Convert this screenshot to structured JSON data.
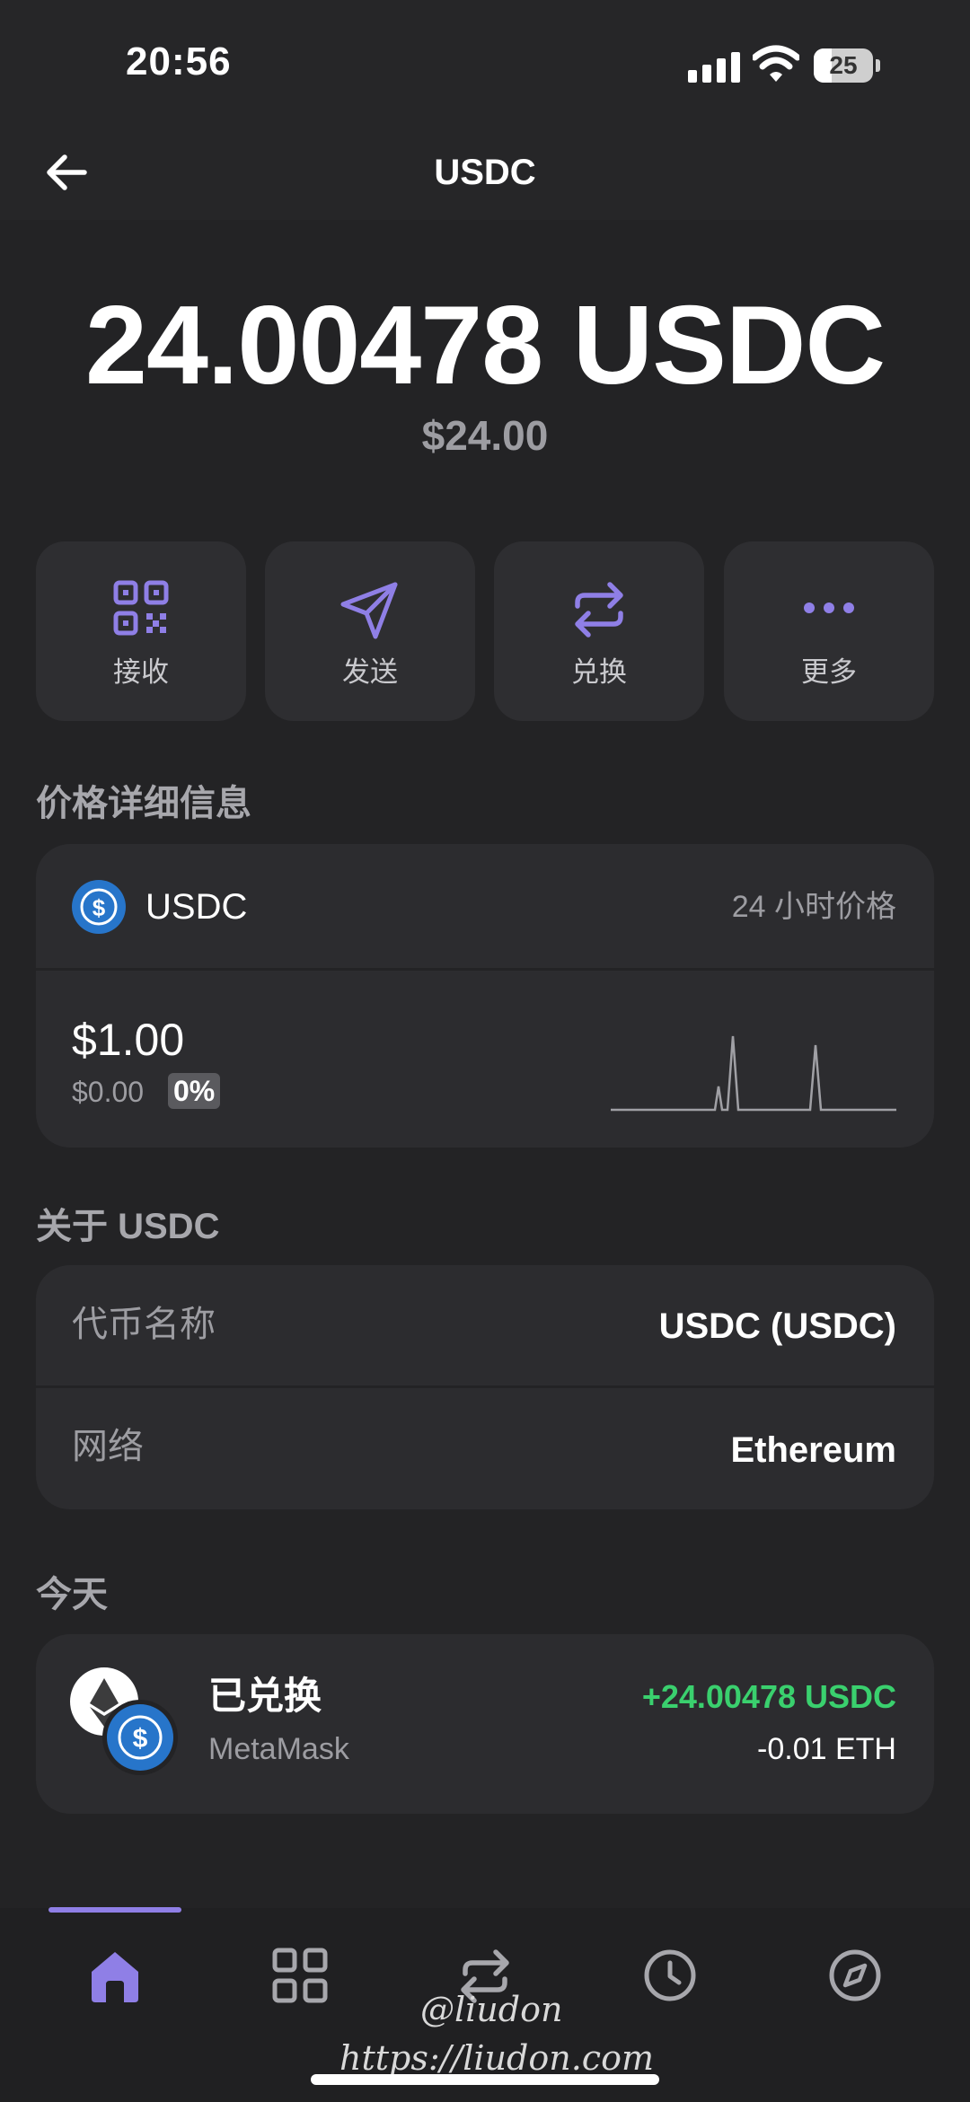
{
  "status_bar": {
    "time": "20:56",
    "battery": "25"
  },
  "header": {
    "title": "USDC"
  },
  "balance": {
    "amount": "24.00478 USDC",
    "fiat": "$24.00"
  },
  "actions": [
    {
      "label": "接收",
      "icon": "qr-code-icon"
    },
    {
      "label": "发送",
      "icon": "send-icon"
    },
    {
      "label": "兑换",
      "icon": "swap-icon"
    },
    {
      "label": "更多",
      "icon": "more-icon"
    }
  ],
  "price_section": {
    "title": "价格详细信息",
    "token": "USDC",
    "period_label": "24 小时价格",
    "price": "$1.00",
    "change": "$0.00",
    "change_pct": "0%"
  },
  "about": {
    "title": "关于 USDC",
    "rows": [
      {
        "label": "代币名称",
        "value": "USDC (USDC)"
      },
      {
        "label": "网络",
        "value": "Ethereum"
      }
    ]
  },
  "activity": {
    "title": "今天",
    "items": [
      {
        "title": "已兑换",
        "subtitle": "MetaMask",
        "amount_in": "+24.00478 USDC",
        "amount_out": "-0.01 ETH"
      }
    ]
  },
  "bottom_nav": [
    {
      "name": "home",
      "icon": "home-icon",
      "active": true
    },
    {
      "name": "apps",
      "icon": "grid-icon",
      "active": false
    },
    {
      "name": "swap",
      "icon": "swap-icon",
      "active": false
    },
    {
      "name": "activity",
      "icon": "clock-icon",
      "active": false
    },
    {
      "name": "explore",
      "icon": "compass-icon",
      "active": false
    }
  ],
  "watermark": {
    "handle": "@liudon",
    "url": "https://liudon.com"
  },
  "colors": {
    "background": "#232325",
    "card": "#2c2c2f",
    "accent": "#8f7fe6",
    "positive": "#3ad06e",
    "muted": "#9d9da2"
  }
}
